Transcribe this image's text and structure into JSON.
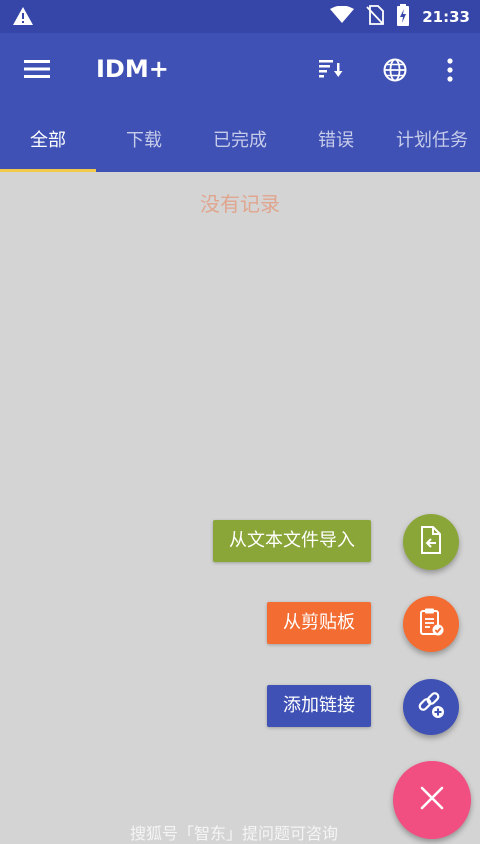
{
  "status_bar": {
    "time": "21:33"
  },
  "app_bar": {
    "title": "IDM+"
  },
  "tabs": [
    {
      "label": "全部",
      "active": true
    },
    {
      "label": "下载",
      "active": false
    },
    {
      "label": "已完成",
      "active": false
    },
    {
      "label": "错误",
      "active": false
    },
    {
      "label": "计划任务",
      "active": false
    }
  ],
  "empty_message": "没有记录",
  "fab_actions": [
    {
      "label": "从文本文件导入",
      "color": "#8ba638",
      "icon": "file-import-icon"
    },
    {
      "label": "从剪贴板",
      "color": "#f36c32",
      "icon": "clipboard-check-icon"
    },
    {
      "label": "添加链接",
      "color": "#3f51b5",
      "icon": "add-link-icon"
    }
  ],
  "fab_main": {
    "icon": "close-icon",
    "color": "#f14e82"
  },
  "footer": {
    "text": "搜狐号「智东」提问题可咨询"
  },
  "colors": {
    "app_bar": "#3f51b5",
    "status_bar": "#3646a8",
    "tab_indicator": "#f3c94a",
    "background": "#d4d4d4"
  }
}
